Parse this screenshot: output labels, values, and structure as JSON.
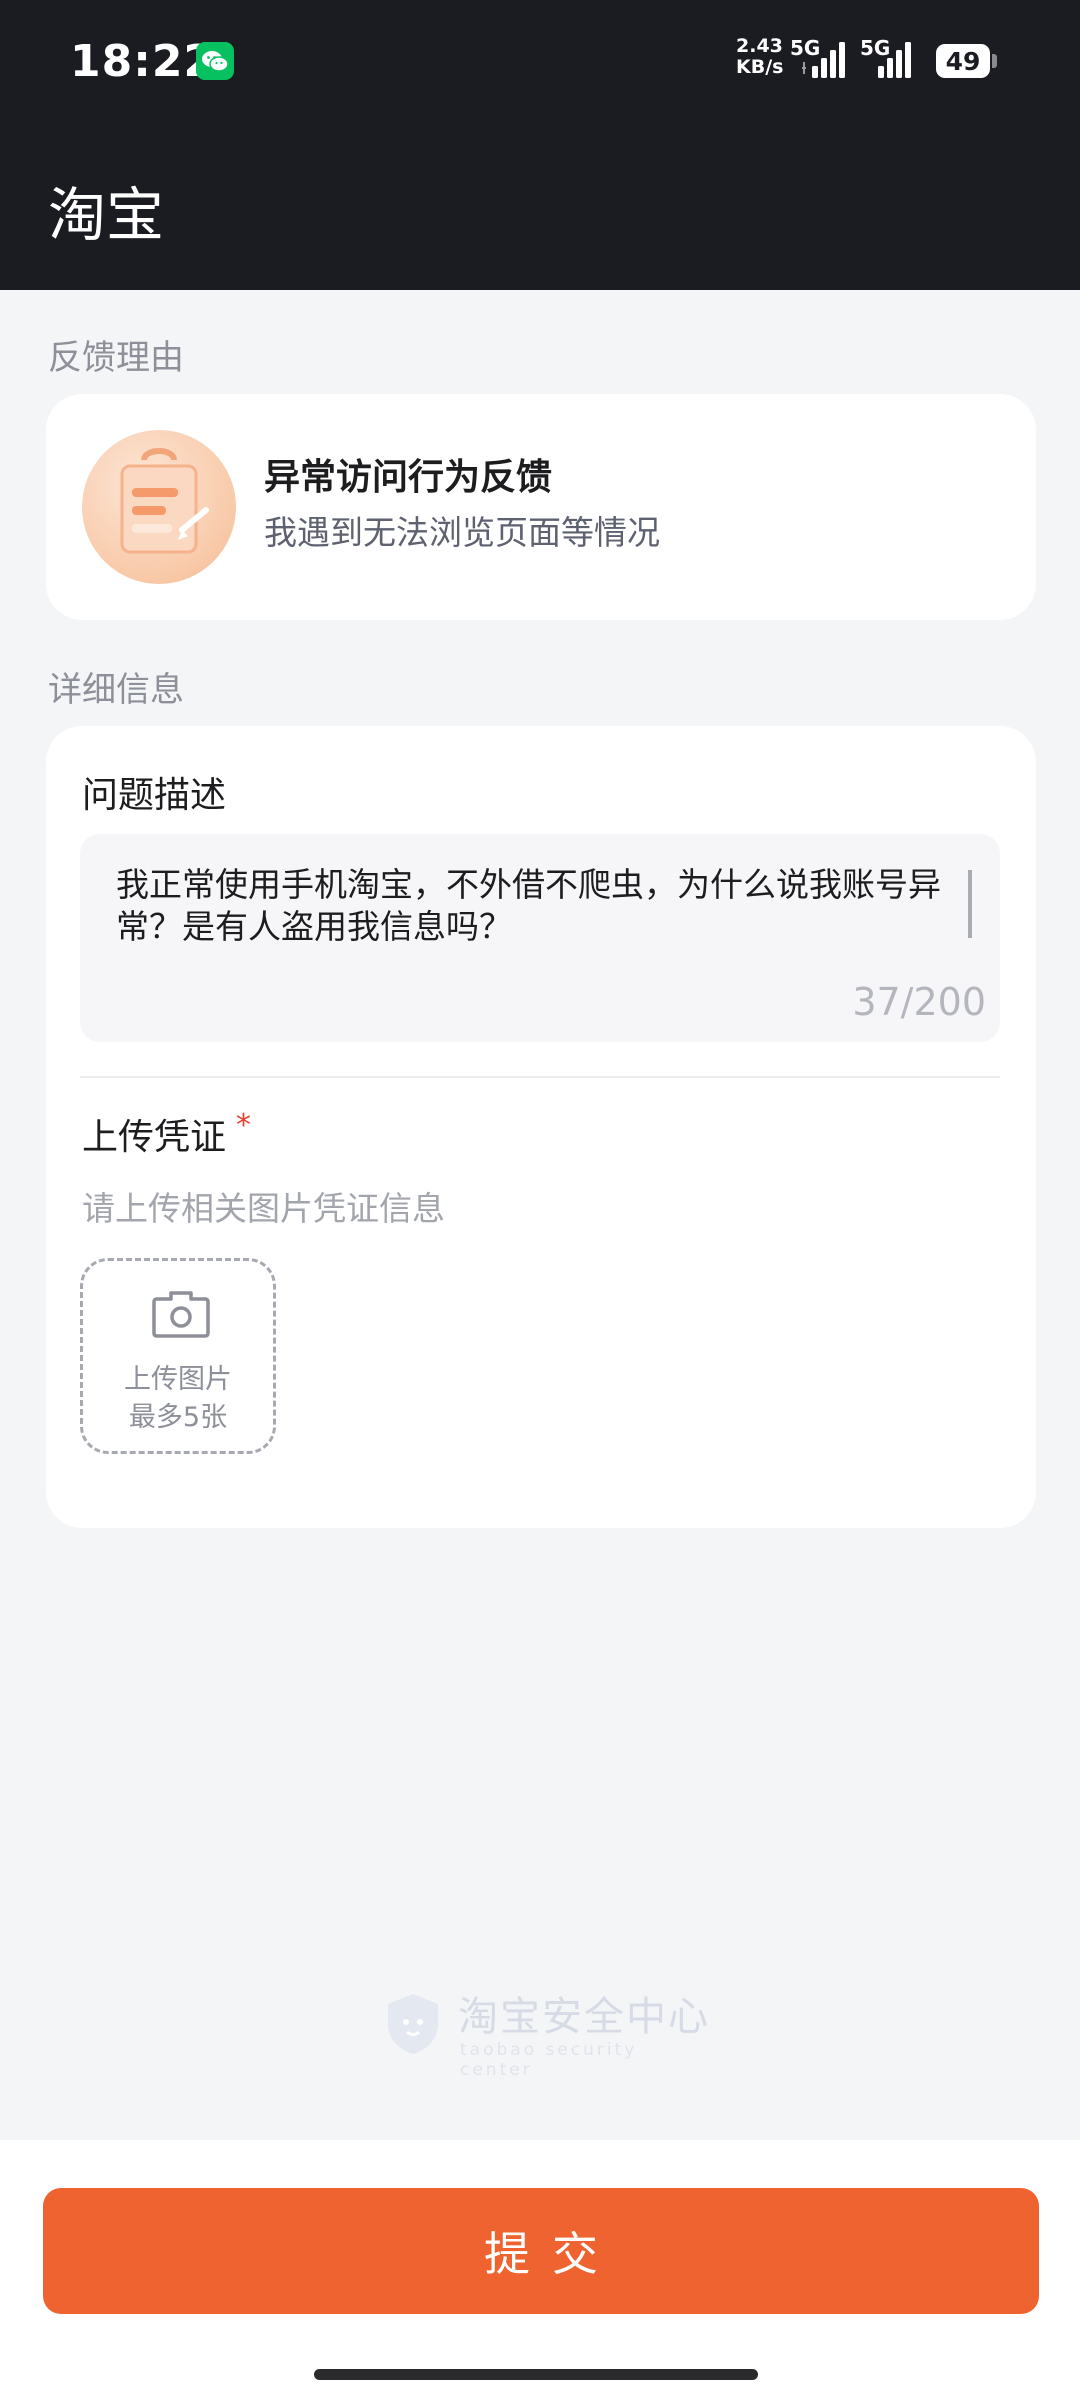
{
  "status_bar": {
    "time": "18:22",
    "net_speed_value": "2.43",
    "net_speed_unit": "KB/s",
    "signal_1_label": "5G",
    "signal_2_label": "5G",
    "battery_level": "49"
  },
  "header": {
    "title": "淘宝"
  },
  "feedback_reason": {
    "section_label": "反馈理由",
    "title": "异常访问行为反馈",
    "subtitle": "我遇到无法浏览页面等情况"
  },
  "details": {
    "section_label": "详细信息",
    "description_label": "问题描述",
    "description_value": "我正常使用手机淘宝，不外借不爬虫，为什么说我账号异常？是有人盗用我信息吗？",
    "char_count": "37/200",
    "upload_label": "上传凭证",
    "required_mark": "*",
    "upload_hint": "请上传相关图片凭证信息",
    "upload_button_line1": "上传图片",
    "upload_button_line2": "最多5张"
  },
  "watermark": {
    "title": "淘宝安全中心",
    "subtitle": "taobao security center"
  },
  "footer": {
    "submit_label": "提交"
  },
  "colors": {
    "accent": "#ee632f",
    "header_bg": "#1b1c22",
    "page_bg": "#f4f5f7",
    "required": "#e6402f",
    "wechat": "#07c160"
  },
  "icons": {
    "wechat": "wechat-icon",
    "camera": "camera-icon",
    "shield": "shield-icon"
  }
}
